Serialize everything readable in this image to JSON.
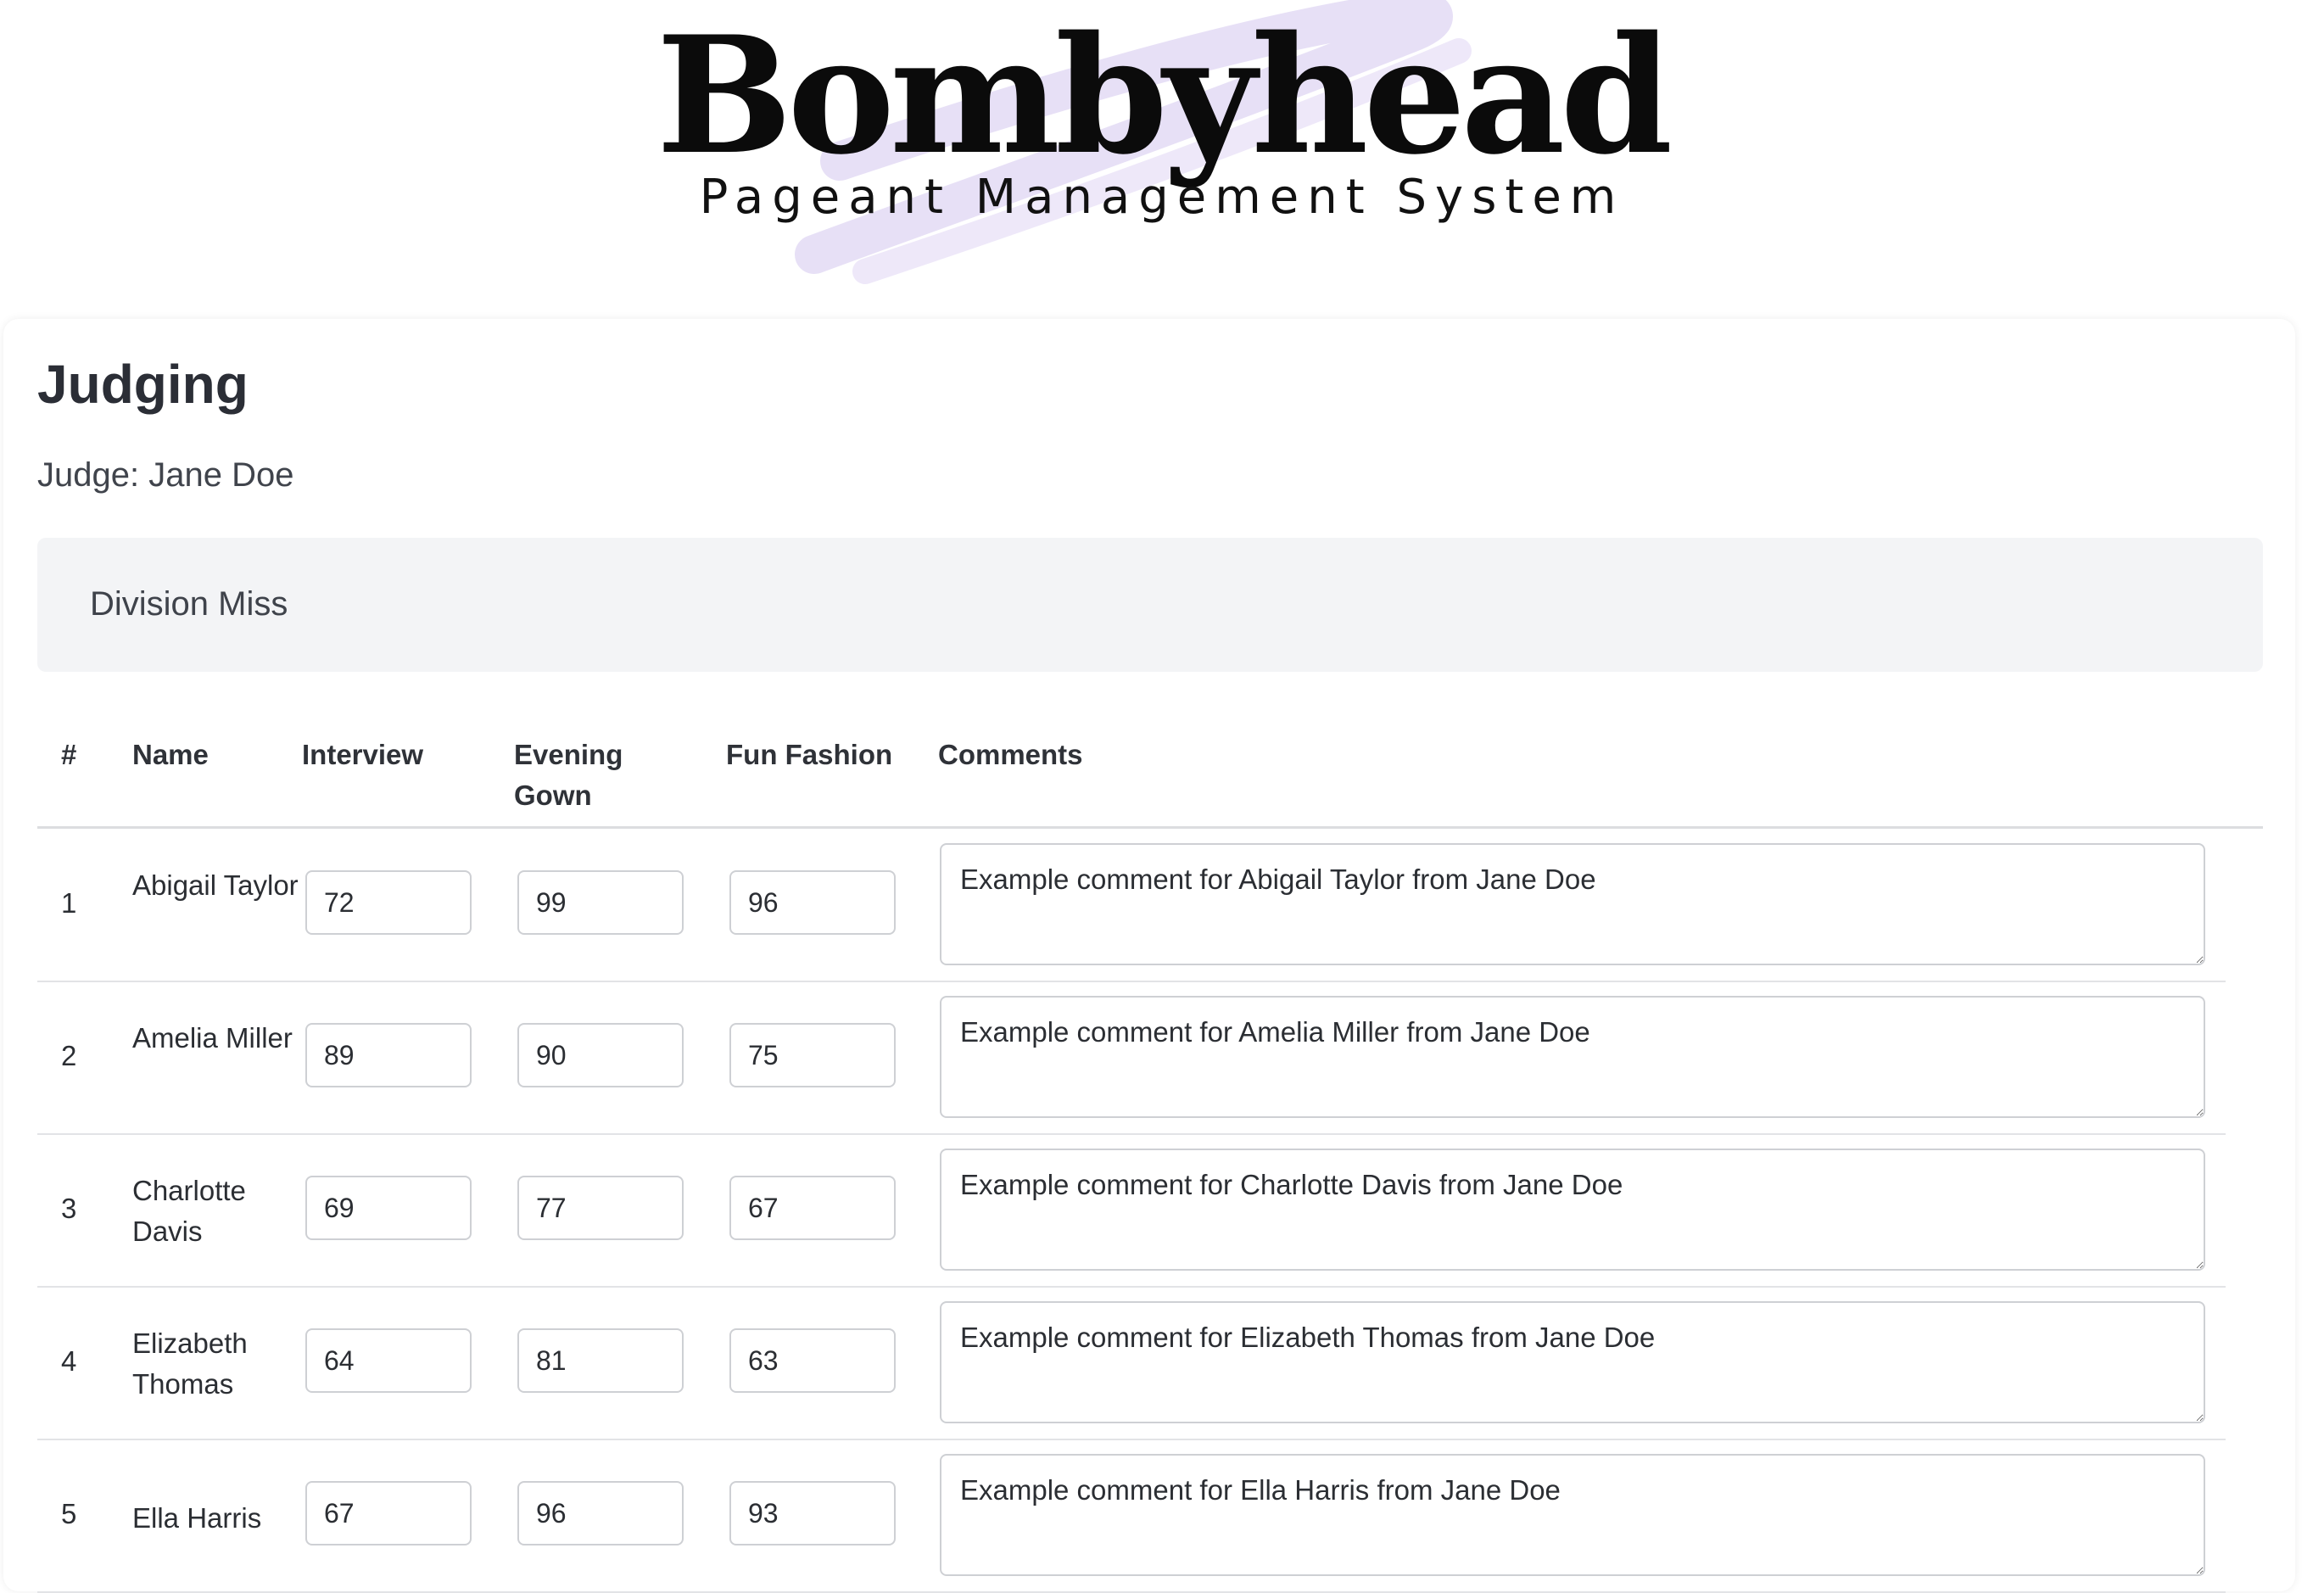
{
  "brand": {
    "title": "Bombyhead",
    "subtitle": "Pageant Management System",
    "accent_color": "#e4dcf4"
  },
  "page": {
    "title": "Judging",
    "judge_label": "Judge: Jane Doe"
  },
  "division": {
    "label": "Division Miss"
  },
  "table": {
    "headers": {
      "number": "#",
      "name": "Name",
      "interview": "Interview",
      "evening_gown": "Evening Gown",
      "fun_fashion": "Fun Fashion",
      "comments": "Comments"
    },
    "rows": [
      {
        "number": "1",
        "name": "Abigail Taylor",
        "interview": "72",
        "evening_gown": "99",
        "fun_fashion": "96",
        "comment": "Example comment for Abigail Taylor from Jane Doe"
      },
      {
        "number": "2",
        "name": "Amelia Miller",
        "interview": "89",
        "evening_gown": "90",
        "fun_fashion": "75",
        "comment": "Example comment for Amelia Miller from Jane Doe"
      },
      {
        "number": "3",
        "name": "Charlotte Davis",
        "interview": "69",
        "evening_gown": "77",
        "fun_fashion": "67",
        "comment": "Example comment for Charlotte Davis from Jane Doe"
      },
      {
        "number": "4",
        "name": "Elizabeth Thomas",
        "interview": "64",
        "evening_gown": "81",
        "fun_fashion": "63",
        "comment": "Example comment for Elizabeth Thomas from Jane Doe"
      },
      {
        "number": "5",
        "name": "Ella Harris",
        "interview": "67",
        "evening_gown": "96",
        "fun_fashion": "93",
        "comment": "Example comment for Ella Harris from Jane Doe"
      }
    ]
  }
}
